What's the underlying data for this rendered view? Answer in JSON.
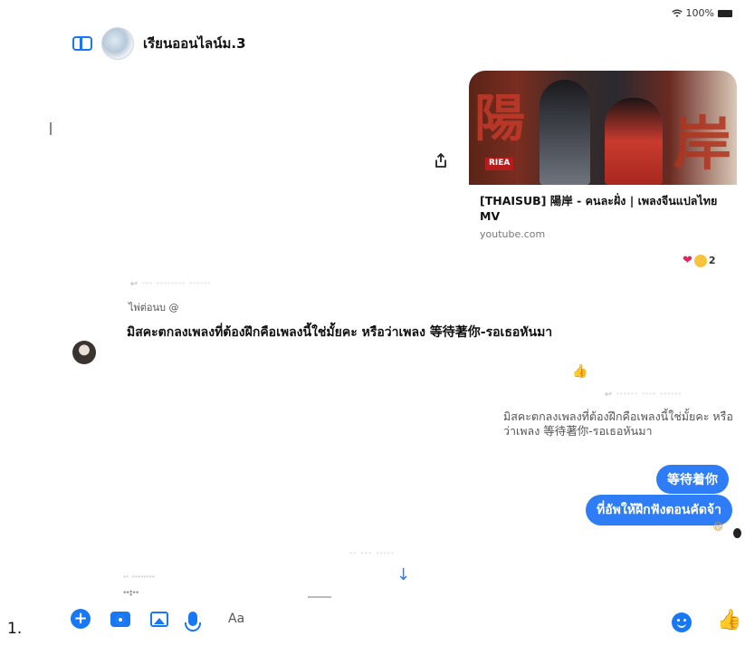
{
  "status_bar": {
    "wifi_icon": "wifi-icon",
    "battery": "100%"
  },
  "header": {
    "title": "เรียนออนไลน์ม.3"
  },
  "link_card": {
    "thumb_char_left": "陽",
    "thumb_char_right": "岸",
    "thumb_badge": "RIEA",
    "title": "[THAISUB] 陽岸 - คนละฝั่ง | เพลงจีนแปลไทย MV",
    "domain": "youtube.com",
    "reaction_count": "2"
  },
  "left_message": {
    "sender": "ไพ่ต่อนบ @",
    "text": "มิสคะตกลงเพลงที่ต้องฝึกคือเพลงนี้ใช่มั้ยคะ หรือว่าเพลง 等待著你-รอเธอหันมา"
  },
  "quoted_reply": {
    "text": "มิสคะตกลงเพลงที่ต้องฝึกคือเพลงนี้ใช่มั้ยคะ หรือว่าเพลง 等待著你-รอเธอหันมา"
  },
  "outgoing": [
    {
      "text": "等待着你"
    },
    {
      "text": "ที่อัพให้ฝึกฟังตอนคัดจ้า"
    }
  ],
  "composer": {
    "placeholder": "Aa"
  },
  "list_number": "1."
}
